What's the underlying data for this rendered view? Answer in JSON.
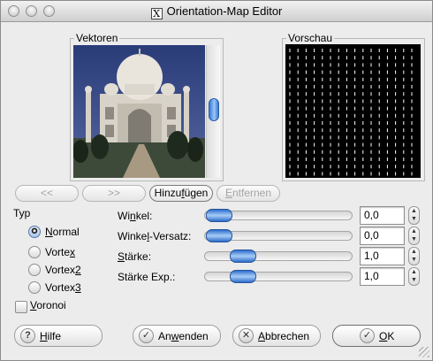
{
  "window": {
    "title": "Orientation-Map Editor",
    "icon": "x11-icon"
  },
  "panels": {
    "vectors_label": "Vektoren",
    "preview_label": "Vorschau",
    "image_subject": "Taj Mahal photograph"
  },
  "vector_buttons": {
    "prev": "<<",
    "next": ">>",
    "add_pre": "Hinzu",
    "add_acc": "f",
    "add_post": "ügen",
    "remove_pre": "",
    "remove_acc": "E",
    "remove_post": "ntfernen"
  },
  "type": {
    "label": "Typ",
    "selected": "Normal",
    "options": [
      {
        "pre": "",
        "acc": "N",
        "post": "ormal"
      },
      {
        "pre": "Vorte",
        "acc": "x",
        "post": ""
      },
      {
        "pre": "Vortex",
        "acc": "2",
        "post": ""
      },
      {
        "pre": "Vortex",
        "acc": "3",
        "post": ""
      }
    ],
    "voronoi": {
      "pre": "",
      "acc": "V",
      "post": "oronoi",
      "checked": false
    }
  },
  "sliders": [
    {
      "pre": "Wi",
      "acc": "n",
      "post": "kel:",
      "value": "0,0",
      "fraction": 0.0
    },
    {
      "pre": "Winke",
      "acc": "l",
      "post": "-Versatz:",
      "value": "0,0",
      "fraction": 0.0
    },
    {
      "pre": "",
      "acc": "S",
      "post": "tärke:",
      "value": "1,0",
      "fraction": 0.2
    },
    {
      "pre": "Stärke Exp.:",
      "acc": "",
      "post": "",
      "value": "1,0",
      "fraction": 0.2
    }
  ],
  "buttons": {
    "help": {
      "pre": "",
      "acc": "H",
      "post": "ilfe",
      "icon": "question-icon"
    },
    "apply": {
      "pre": "An",
      "acc": "w",
      "post": "enden",
      "icon": "checkmark-icon"
    },
    "cancel": {
      "pre": "",
      "acc": "A",
      "post": "bbrechen",
      "icon": "x-icon"
    },
    "ok": {
      "pre": "",
      "acc": "O",
      "post": "K",
      "icon": "checkmark-icon"
    }
  },
  "colors": {
    "accent_blue": "#3a79d6",
    "preview_bg": "#000000",
    "preview_lines": "#ffffff"
  }
}
